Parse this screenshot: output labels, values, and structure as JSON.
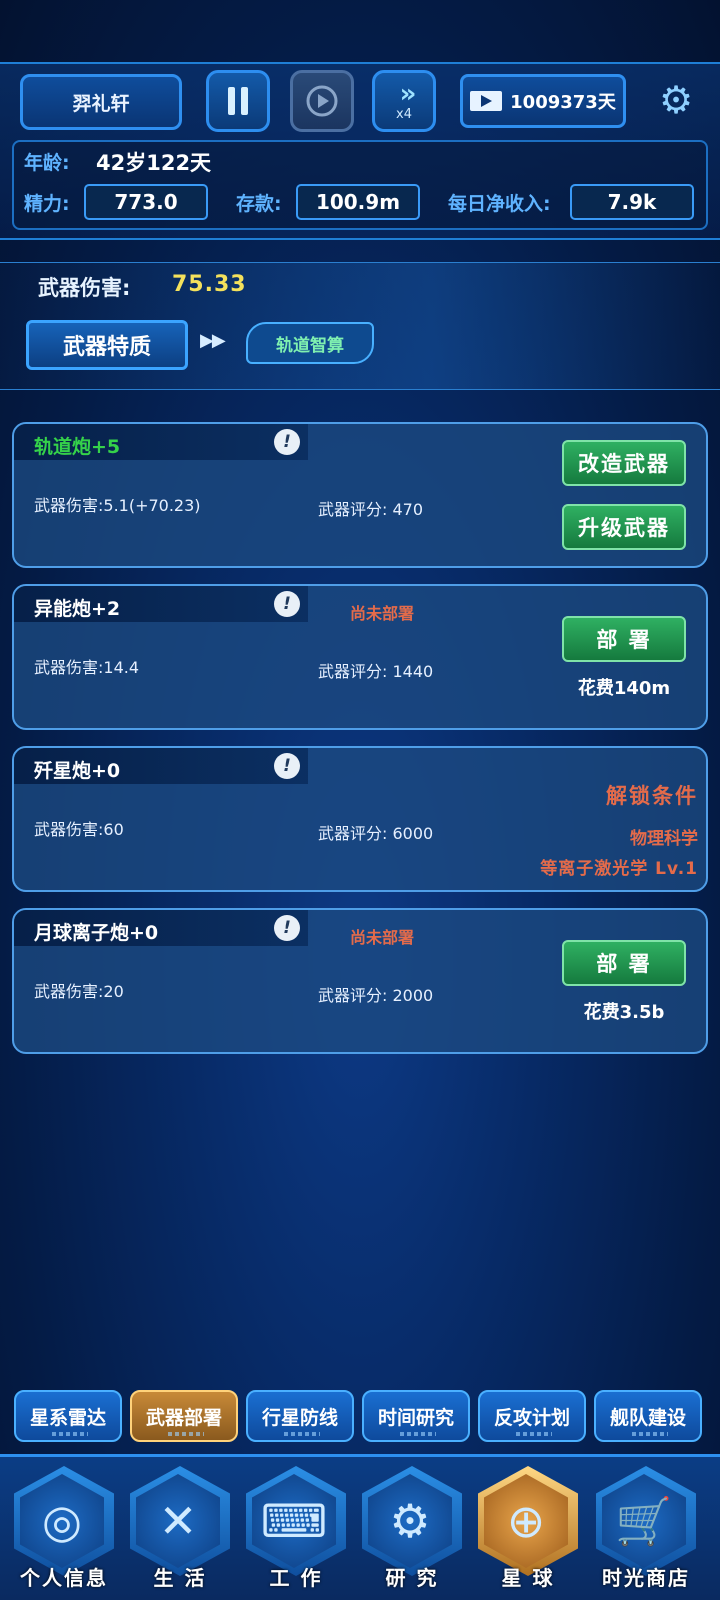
{
  "header": {
    "player_name": "羿礼轩",
    "speed_label": "x4",
    "days": "1009373天"
  },
  "stats": {
    "age_label": "年龄:",
    "age_value": "42岁122天",
    "energy_label": "精力:",
    "energy_value": "773.0",
    "savings_label": "存款:",
    "savings_value": "100.9m",
    "income_label": "每日净收入:",
    "income_value": "7.9k"
  },
  "damage": {
    "label": "武器伤害:",
    "value": "75.33",
    "trait_button": "武器特质",
    "trait_tag": "轨道智算"
  },
  "weapons": [
    {
      "name": "轨道炮+5",
      "damage": "武器伤害:5.1(+70.23)",
      "score": "武器评分: 470",
      "modify_button": "改造武器",
      "upgrade_button": "升级武器"
    },
    {
      "name": "异能炮+2",
      "status": "尚未部署",
      "damage": "武器伤害:14.4",
      "score": "武器评分: 1440",
      "deploy_button": "部 署",
      "cost": "花费140m"
    },
    {
      "name": "歼星炮+0",
      "damage": "武器伤害:60",
      "score": "武器评分: 6000",
      "unlock_title": "解锁条件",
      "unlock_req1": "物理科学",
      "unlock_req2": "等离子激光学 Lv.1"
    },
    {
      "name": "月球离子炮+0",
      "status": "尚未部署",
      "damage": "武器伤害:20",
      "score": "武器评分: 2000",
      "deploy_button": "部 署",
      "cost": "花费3.5b"
    }
  ],
  "subtabs": [
    "星系雷达",
    "武器部署",
    "行星防线",
    "时间研究",
    "反攻计划",
    "舰队建设"
  ],
  "nav": [
    "个人信息",
    "生 活",
    "工 作",
    "研 究",
    "星 球",
    "时光商店"
  ],
  "icons": {
    "pause": "pause-icon",
    "disabled": "record-icon",
    "speed": "fast-forward-icon",
    "video": "video-icon",
    "settings": "gear-icon"
  }
}
